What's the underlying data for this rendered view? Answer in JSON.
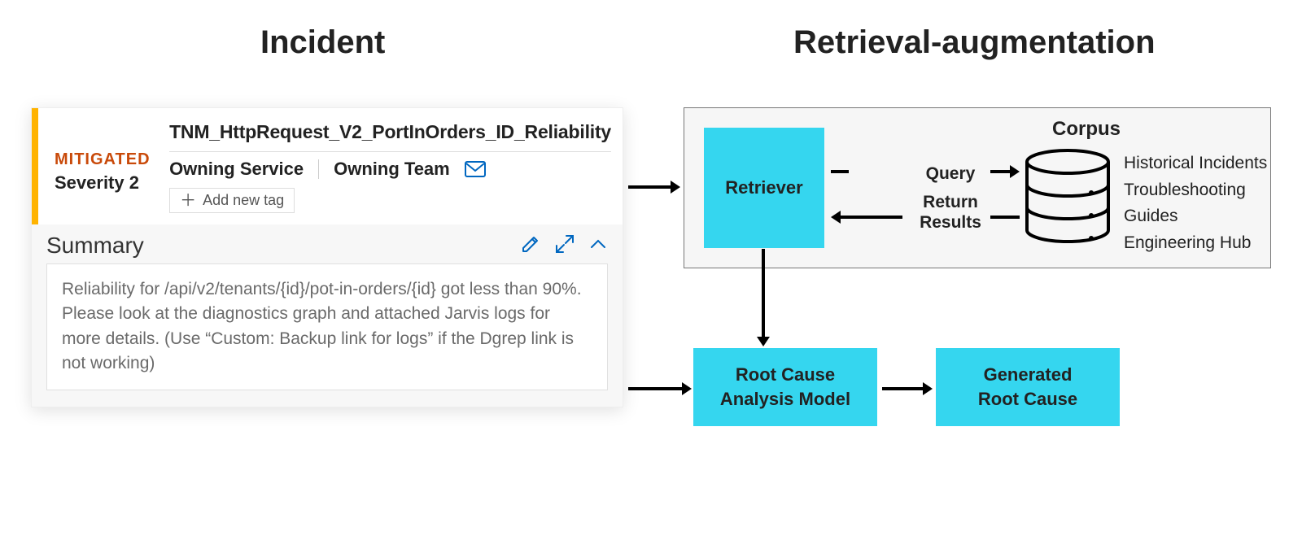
{
  "headings": {
    "incident": "Incident",
    "retrieval": "Retrieval-augmentation"
  },
  "incident": {
    "status": "MITIGATED",
    "severity": "Severity 2",
    "title": "TNM_HttpRequest_V2_PortInOrders_ID_Reliability",
    "owning_service": "Owning Service",
    "owning_team": "Owning Team",
    "add_tag": "Add new tag",
    "summary_heading": "Summary",
    "summary_body": "Reliability for /api/v2/tenants/{id}/pot-in-orders/{id} got less than 90%. Please look at the diagnostics graph and attached Jarvis logs for more details. (Use “Custom: Backup link for logs” if the Dgrep link is not working)"
  },
  "retrieval": {
    "retriever": "Retriever",
    "query": "Query",
    "return": "Return",
    "results": "Results",
    "corpus_label": "Corpus",
    "corpus_items": {
      "a": "Historical Incidents",
      "b": "Troubleshooting Guides",
      "c": "Engineering Hub"
    },
    "rca_model": "Root Cause\nAnalysis Model",
    "generated": "Generated\nRoot Cause"
  }
}
